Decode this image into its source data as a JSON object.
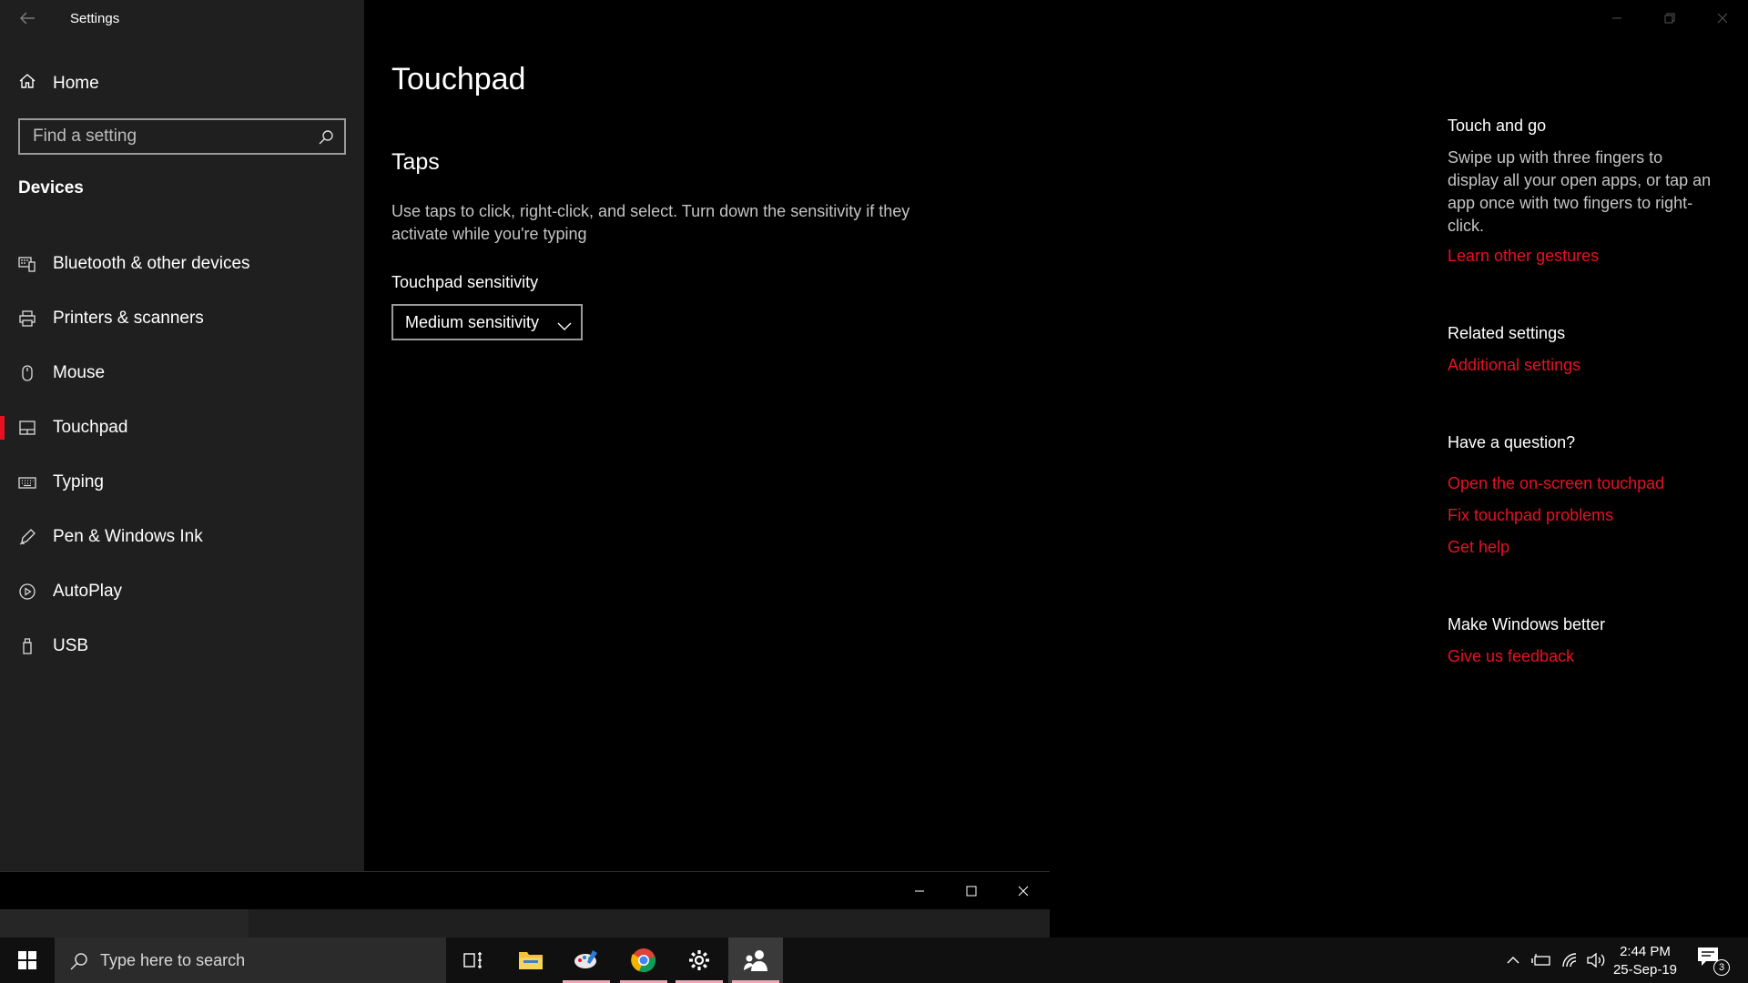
{
  "window": {
    "title": "Settings"
  },
  "sidebar": {
    "home_label": "Home",
    "search_placeholder": "Find a setting",
    "section_title": "Devices",
    "items": [
      {
        "label": "Bluetooth & other devices",
        "icon": "bluetooth-devices-icon"
      },
      {
        "label": "Printers & scanners",
        "icon": "printer-icon"
      },
      {
        "label": "Mouse",
        "icon": "mouse-icon"
      },
      {
        "label": "Touchpad",
        "icon": "touchpad-icon",
        "active": true
      },
      {
        "label": "Typing",
        "icon": "keyboard-icon"
      },
      {
        "label": "Pen & Windows Ink",
        "icon": "pen-icon"
      },
      {
        "label": "AutoPlay",
        "icon": "autoplay-icon"
      },
      {
        "label": "USB",
        "icon": "usb-icon"
      }
    ]
  },
  "main": {
    "page_title": "Touchpad",
    "section_title": "Taps",
    "description": "Use taps to click, right-click, and select. Turn down the sensitivity if they activate while you're typing",
    "sensitivity_label": "Touchpad sensitivity",
    "sensitivity_value": "Medium sensitivity"
  },
  "right_panel": {
    "touch_and_go": {
      "heading": "Touch and go",
      "text": "Swipe up with three fingers to display all your open apps, or tap an app once with two fingers to right-click.",
      "link": "Learn other gestures"
    },
    "related": {
      "heading": "Related settings",
      "link": "Additional settings"
    },
    "question": {
      "heading": "Have a question?",
      "links": [
        "Open the on-screen touchpad",
        "Fix touchpad problems",
        "Get help"
      ]
    },
    "better": {
      "heading": "Make Windows better",
      "link": "Give us feedback"
    }
  },
  "taskbar": {
    "search_placeholder": "Type here to search",
    "time": "2:44 PM",
    "date": "25-Sep-19",
    "notification_count": "3",
    "apps": [
      "task-view",
      "file-explorer",
      "paint",
      "chrome",
      "settings",
      "people"
    ]
  },
  "colors": {
    "accent": "#e81123",
    "sidebar_bg": "#1f1f1f",
    "main_bg": "#000000",
    "taskbar_bg": "#101010"
  }
}
